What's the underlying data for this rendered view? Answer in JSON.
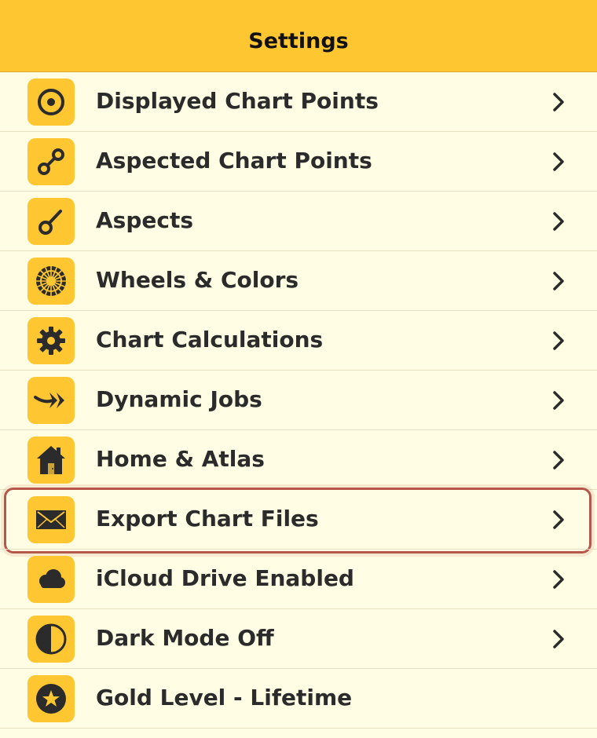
{
  "header": {
    "title": "Settings"
  },
  "items": [
    {
      "label": "Displayed Chart Points",
      "icon": "target-circle-icon"
    },
    {
      "label": "Aspected Chart Points",
      "icon": "link-nodes-icon"
    },
    {
      "label": "Aspects",
      "icon": "aspect-line-icon"
    },
    {
      "label": "Wheels & Colors",
      "icon": "wheel-icon"
    },
    {
      "label": "Chart Calculations",
      "icon": "gear-icon"
    },
    {
      "label": "Dynamic Jobs",
      "icon": "double-arrow-icon"
    },
    {
      "label": "Home & Atlas",
      "icon": "house-icon"
    },
    {
      "label": "Export Chart Files",
      "icon": "envelope-icon",
      "highlighted": true
    },
    {
      "label": "iCloud Drive Enabled",
      "icon": "cloud-icon"
    },
    {
      "label": "Dark Mode Off",
      "icon": "half-circle-icon"
    },
    {
      "label": "Gold Level - Lifetime",
      "icon": "star-circle-icon"
    }
  ],
  "colors": {
    "header": "#fec732",
    "background": "#fffde3",
    "icon_tile": "#fec732",
    "highlight_border": "#b5584b",
    "text": "#2b2b2b"
  }
}
